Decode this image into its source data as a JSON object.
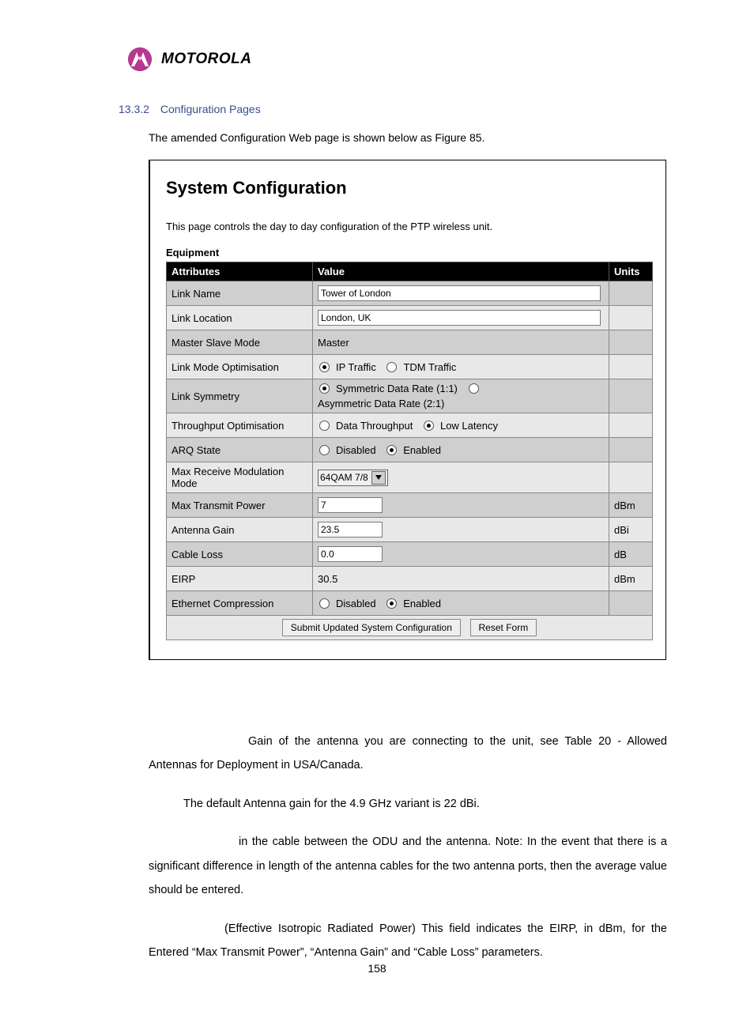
{
  "brand": "MOTOROLA",
  "section": {
    "number": "13.3.2",
    "title": "Configuration Pages"
  },
  "intro": "The amended Configuration Web page is shown below as Figure 85.",
  "panel": {
    "title": "System Configuration",
    "description": "This page controls the day to day configuration of the PTP wireless unit.",
    "group_label": "Equipment",
    "headers": {
      "attr": "Attributes",
      "value": "Value",
      "units": "Units"
    },
    "rows": {
      "link_name": {
        "label": "Link Name",
        "value": "Tower of London"
      },
      "link_location": {
        "label": "Link Location",
        "value": "London, UK"
      },
      "master_slave": {
        "label": "Master Slave Mode",
        "value": "Master"
      },
      "link_mode_opt": {
        "label": "Link Mode Optimisation",
        "opt1": "IP Traffic",
        "opt2": "TDM Traffic"
      },
      "link_symmetry": {
        "label": "Link Symmetry",
        "opt1": "Symmetric Data Rate (1:1)",
        "opt2": "Asymmetric Data Rate (2:1)"
      },
      "throughput_opt": {
        "label": "Throughput Optimisation",
        "opt1": "Data Throughput",
        "opt2": "Low Latency"
      },
      "arq_state": {
        "label": "ARQ State",
        "opt1": "Disabled",
        "opt2": "Enabled"
      },
      "max_rx_mod": {
        "label": "Max Receive Modulation Mode",
        "value": "64QAM 7/8"
      },
      "max_tx_power": {
        "label": "Max Transmit Power",
        "value": "7",
        "units": "dBm"
      },
      "antenna_gain": {
        "label": "Antenna Gain",
        "value": "23.5",
        "units": "dBi"
      },
      "cable_loss": {
        "label": "Cable Loss",
        "value": "0.0",
        "units": "dB"
      },
      "eirp": {
        "label": "EIRP",
        "value": "30.5",
        "units": "dBm"
      },
      "eth_compression": {
        "label": "Ethernet Compression",
        "opt1": "Disabled",
        "opt2": "Enabled"
      }
    },
    "buttons": {
      "submit": "Submit Updated System Configuration",
      "reset": "Reset Form"
    }
  },
  "paragraphs": {
    "p1": "Gain of the antenna you are connecting to the unit, see Table 20 - Allowed Antennas for Deployment in USA/Canada.",
    "note": "The default Antenna gain for the 4.9 GHz variant is 22 dBi.",
    "p2": "in the cable between the ODU and the antenna. Note: In the event that there is a significant difference in length of the antenna cables for the two antenna ports, then the average value should be entered.",
    "p3": "(Effective Isotropic Radiated Power) This field indicates the EIRP, in dBm, for the Entered “Max Transmit Power”, “Antenna Gain” and “Cable Loss” parameters."
  },
  "page_number": "158"
}
